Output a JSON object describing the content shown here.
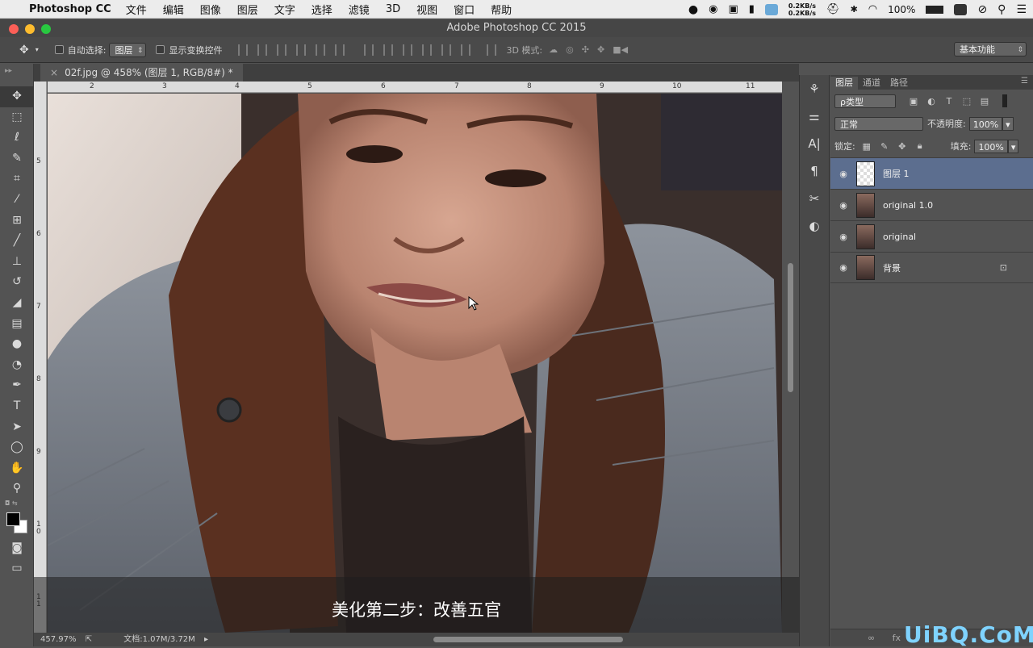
{
  "menubar": {
    "app_name": "Photoshop CC",
    "items": [
      "文件",
      "编辑",
      "图像",
      "图层",
      "文字",
      "选择",
      "滤镜",
      "3D",
      "视图",
      "窗口",
      "帮助"
    ],
    "net_up": "0.2KB/s",
    "net_down": "0.2KB/s",
    "battery": "100%"
  },
  "window": {
    "title": "Adobe Photoshop CC 2015"
  },
  "options": {
    "auto_select_label": "自动选择:",
    "auto_select_value": "图层",
    "show_transform_label": "显示变换控件",
    "mode_3d_label": "3D 模式:",
    "workspace": "基本功能"
  },
  "document": {
    "tab_label": "02f.jpg @ 458% (图层 1, RGB/8#) *",
    "ruler_h": [
      "2",
      "3",
      "4",
      "5",
      "6",
      "7",
      "8",
      "9",
      "10",
      "11"
    ],
    "ruler_v": [
      "5",
      "6",
      "7",
      "8",
      "9",
      "1 0",
      "1 1"
    ]
  },
  "status": {
    "zoom": "457.97%",
    "doc_size": "文档:1.07M/3.72M"
  },
  "subtitle": "美化第二步：改善五官",
  "panel": {
    "tabs": [
      "图层",
      "通道",
      "路径"
    ],
    "filter_kind": "ρ类型",
    "blend_mode": "正常",
    "opacity_label": "不透明度:",
    "opacity": "100%",
    "lock_label": "锁定:",
    "fill_label": "填充:",
    "fill": "100%",
    "layers": [
      {
        "name": "图层 1",
        "selected": true
      },
      {
        "name": "original 1.0"
      },
      {
        "name": "original"
      },
      {
        "name": "背景",
        "locked": true
      }
    ]
  },
  "watermark": "UiBQ.CoM",
  "colors": {
    "accent_selected": "#5c6e8f",
    "panel": "#535353"
  }
}
